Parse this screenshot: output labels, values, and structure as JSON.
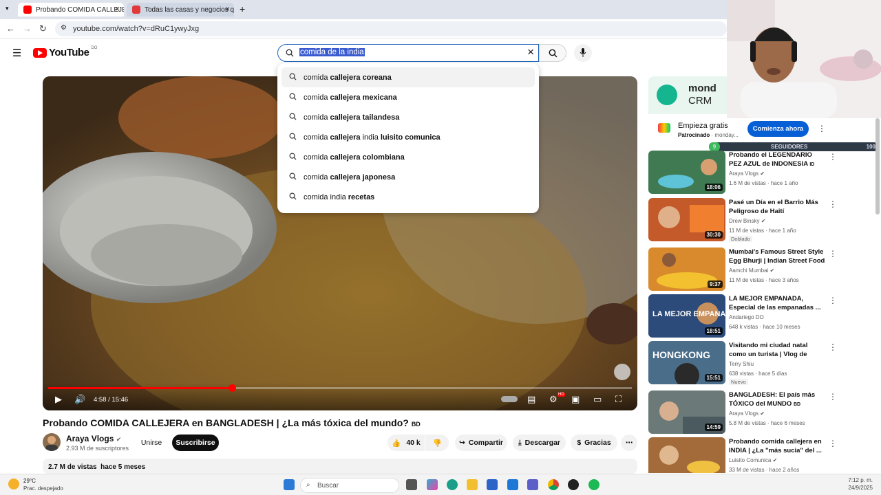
{
  "browser": {
    "tabs": [
      {
        "label": "Probando COMIDA CALLEJERA"
      },
      {
        "label": "Todas las casas y negocios que"
      }
    ],
    "new_tab": "+",
    "url": "youtube.com/watch?v=dRuC1ywyJxg"
  },
  "youtube": {
    "logo_text": "YouTube",
    "country_code": "DO",
    "search_query": "comida de la india",
    "suggestions": [
      {
        "prefix": "comida",
        "bold": "callejera coreana",
        "tail": ""
      },
      {
        "prefix": "comida",
        "bold": "callejera mexicana",
        "tail": ""
      },
      {
        "prefix": "comida",
        "bold": "callejera tailandesa",
        "tail": ""
      },
      {
        "prefix": "comida",
        "bold": "callejera",
        "mid": "india",
        "tail": "luisito comunica"
      },
      {
        "prefix": "comida",
        "bold": "callejera colombiana",
        "tail": ""
      },
      {
        "prefix": "comida",
        "bold": "callejera japonesa",
        "tail": ""
      },
      {
        "prefix": "comida india",
        "bold": "recetas",
        "tail": ""
      }
    ]
  },
  "player": {
    "time": "4:58 / 15:46",
    "progress": 0.315,
    "hd_badge": "HD"
  },
  "video": {
    "title": "Probando COMIDA CALLEJERA en BANGLADESH | ¿La más tóxica del mundo?",
    "title_flag": "BD",
    "channel": "Araya Vlogs",
    "subscribers": "2.93 M de suscriptores",
    "join": "Unirse",
    "subscribe": "Suscribirse",
    "likes": "40 k",
    "share": "Compartir",
    "download": "Descargar",
    "thanks": "Gracias",
    "views": "2.7 M de vistas",
    "age": "hace 5 meses"
  },
  "ad": {
    "brand_line1": "mond",
    "brand_line2": "CRM",
    "headline": "Empieza gratis",
    "sponsored": "Patrocinado",
    "domain": "monday...",
    "cta": "Comienza ahora"
  },
  "overlay": {
    "followers_count": "9",
    "followers_label": "SEGUIDORES",
    "followers_goal": "100"
  },
  "recommendations": [
    {
      "title": "Probando el LEGENDARIO PEZ AZUL de INDONESIA",
      "flag": "ID",
      "channel": "Araya Vlogs",
      "meta": "1.6 M de vistas · hace 1 año",
      "duration": "18:06",
      "badge": "",
      "color": "#3f7a52"
    },
    {
      "title": "Pasé un Día en el Barrio Más Peligroso de Haití",
      "flag": "",
      "channel": "Drew Binsky",
      "meta": "11 M de vistas · hace 1 año",
      "duration": "30:30",
      "badge": "Doblado",
      "color": "#c45a2a"
    },
    {
      "title": "Mumbai's Famous Street Style Egg Bhurji | Indian Street Food",
      "flag": "",
      "channel": "Aamchi Mumbai",
      "meta": "11 M de vistas · hace 3 años",
      "duration": "9:37",
      "badge": "",
      "color": "#d88a2c"
    },
    {
      "title": "LA MEJOR EMPANADA, Especial de las empanadas ...",
      "flag": "",
      "channel": "Andariego DO",
      "meta": "648 k vistas · hace 10 meses",
      "duration": "18:51",
      "badge": "",
      "color": "#2c4b7a"
    },
    {
      "title": "Visitando mi ciudad natal como un turista | Vlog de Hong Kong...",
      "flag": "",
      "channel": "Terry Shiu",
      "meta": "638 vistas · hace 5 días",
      "duration": "15:51",
      "badge": "Nuevo",
      "color": "#4a6d8a"
    },
    {
      "title": "BANGLADESH: El país más TÓXICO del MUNDO",
      "flag": "BD",
      "channel": "Araya Vlogs",
      "meta": "5.8 M de vistas · hace 6 meses",
      "duration": "14:59",
      "badge": "",
      "color": "#6b7a78"
    },
    {
      "title": "Probando comida callejera en INDIA | ¿La \"más sucia\" del ...",
      "flag": "",
      "channel": "Luisito Comunica",
      "meta": "33 M de vistas · hace 2 años",
      "duration": "",
      "badge": "",
      "color": "#a46b3a"
    }
  ],
  "thumb_texts": {
    "r3": "LA MEJOR EMPANADA",
    "r4": "HONGKONG"
  },
  "taskbar": {
    "temp": "29°C",
    "weather": "Prac. despejado",
    "search": "Buscar",
    "time": "7:12 p. m.",
    "date": "24/9/2025"
  }
}
